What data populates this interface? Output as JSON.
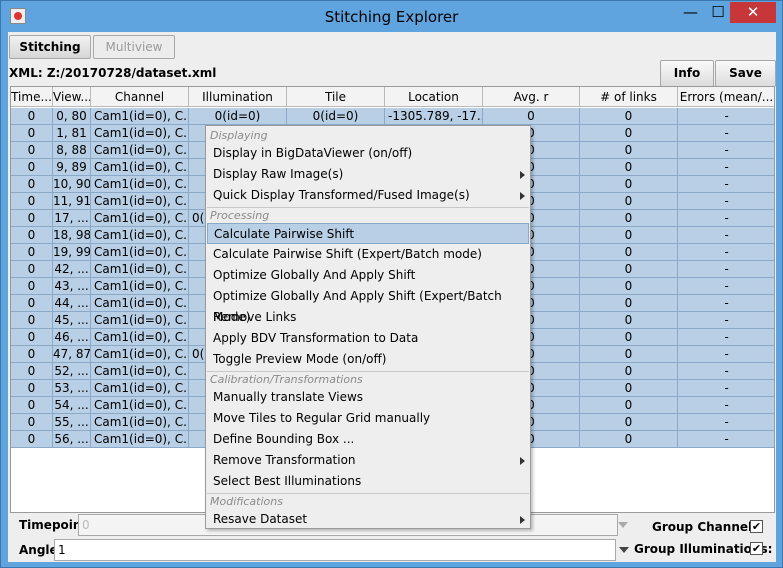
{
  "window": {
    "title": "Stitching Explorer",
    "min_glyph": "—",
    "max_glyph": "☐",
    "close_glyph": "✕"
  },
  "tabs": [
    {
      "label": "Stitching",
      "active": true
    },
    {
      "label": "Multiview",
      "active": false
    }
  ],
  "xml_path": "XML: Z:/20170728/dataset.xml",
  "buttons": {
    "info": "Info",
    "save": "Save"
  },
  "table": {
    "headers": [
      "Time...",
      "View...",
      "Channel",
      "Illumination",
      "Tile",
      "Location",
      "Avg. r",
      "# of links",
      "Errors (mean/..."
    ],
    "rows": [
      [
        "0",
        "0, 80",
        "Cam1(id=0), C...",
        "0(id=0)",
        "0(id=0)",
        "-1305.789, -17...",
        "0",
        "0",
        "-"
      ],
      [
        "0",
        "1, 81",
        "Cam1(id=0), C...",
        "",
        "",
        "",
        "0",
        "0",
        "-"
      ],
      [
        "0",
        "8, 88",
        "Cam1(id=0), C...",
        "",
        "",
        "",
        "0",
        "0",
        "-"
      ],
      [
        "0",
        "9, 89",
        "Cam1(id=0), C...",
        "",
        "",
        "",
        "0",
        "0",
        "-"
      ],
      [
        "0",
        "10, 90",
        "Cam1(id=0), C...",
        "",
        "",
        "",
        "0",
        "0",
        "-"
      ],
      [
        "0",
        "11, 91",
        "Cam1(id=0), C...",
        "",
        "",
        "",
        "0",
        "0",
        "-"
      ],
      [
        "0",
        "17, ...",
        "Cam1(id=0), C...",
        "0(",
        "",
        "",
        "0",
        "0",
        "-"
      ],
      [
        "0",
        "18, 98",
        "Cam1(id=0), C...",
        "",
        "",
        "",
        "0",
        "0",
        "-"
      ],
      [
        "0",
        "19, 99",
        "Cam1(id=0), C...",
        "",
        "",
        "",
        "0",
        "0",
        "-"
      ],
      [
        "0",
        "42, ...",
        "Cam1(id=0), C...",
        "",
        "",
        "",
        "0",
        "0",
        "-"
      ],
      [
        "0",
        "43, ...",
        "Cam1(id=0), C...",
        "",
        "",
        "",
        "0",
        "0",
        "-"
      ],
      [
        "0",
        "44, ...",
        "Cam1(id=0), C...",
        "",
        "",
        "",
        "0",
        "0",
        "-"
      ],
      [
        "0",
        "45, ...",
        "Cam1(id=0), C...",
        "",
        "",
        "",
        "0",
        "0",
        "-"
      ],
      [
        "0",
        "46, ...",
        "Cam1(id=0), C...",
        "",
        "",
        "",
        "0",
        "0",
        "-"
      ],
      [
        "0",
        "47, 87",
        "Cam1(id=0), C...",
        "0(",
        "",
        "",
        "0",
        "0",
        "-"
      ],
      [
        "0",
        "52, ...",
        "Cam1(id=0), C...",
        "",
        "",
        "",
        "0",
        "0",
        "-"
      ],
      [
        "0",
        "53, ...",
        "Cam1(id=0), C...",
        "",
        "",
        "",
        "0",
        "0",
        "-"
      ],
      [
        "0",
        "54, ...",
        "Cam1(id=0), C...",
        "",
        "",
        "",
        "0",
        "0",
        "-"
      ],
      [
        "0",
        "55, ...",
        "Cam1(id=0), C...",
        "",
        "",
        "",
        "0",
        "0",
        "-"
      ],
      [
        "0",
        "56, ...",
        "Cam1(id=0), C...",
        "",
        "",
        "",
        "0",
        "0",
        "-"
      ]
    ]
  },
  "context_menu": {
    "sections": [
      {
        "header": "Displaying",
        "items": [
          {
            "label": "Display in BigDataViewer (on/off)",
            "submenu": false
          },
          {
            "label": "Display Raw Image(s)",
            "submenu": true
          },
          {
            "label": "Quick Display Transformed/Fused Image(s)",
            "submenu": true
          }
        ]
      },
      {
        "header": "Processing",
        "items": [
          {
            "label": "Calculate Pairwise Shift",
            "submenu": false,
            "selected": true
          },
          {
            "label": "Calculate Pairwise Shift (Expert/Batch mode)",
            "submenu": false
          },
          {
            "label": "Optimize Globally And Apply Shift",
            "submenu": false
          },
          {
            "label": "Optimize Globally And Apply Shift (Expert/Batch Mode)",
            "submenu": false
          },
          {
            "label": "Remove Links",
            "submenu": false
          },
          {
            "label": "Apply BDV Transformation to Data",
            "submenu": false
          },
          {
            "label": "Toggle Preview Mode (on/off)",
            "submenu": false
          }
        ]
      },
      {
        "header": "Calibration/Transformations",
        "items": [
          {
            "label": "Manually translate Views",
            "submenu": false
          },
          {
            "label": "Move Tiles to Regular Grid manually",
            "submenu": false
          },
          {
            "label": "Define Bounding Box ...",
            "submenu": false
          },
          {
            "label": "Remove Transformation",
            "submenu": true
          },
          {
            "label": "Select Best Illuminations",
            "submenu": false
          }
        ]
      },
      {
        "header": "Modifications",
        "items": [
          {
            "label": "Resave Dataset",
            "submenu": true
          }
        ]
      }
    ]
  },
  "bottom": {
    "timepoint_label": "Timepoint:",
    "timepoint_value": "0",
    "angle_label": "Angle:",
    "angle_value": "1",
    "group_channels_label": "Group Channels:",
    "group_channels_checked": true,
    "group_illuminations_label": "Group Illuminations:",
    "group_illuminations_checked": true,
    "check_glyph": "✔"
  },
  "colors": {
    "titlebar": "#5fa4de",
    "close_button": "#c7373a",
    "row_selected": "#b8cfe5"
  }
}
